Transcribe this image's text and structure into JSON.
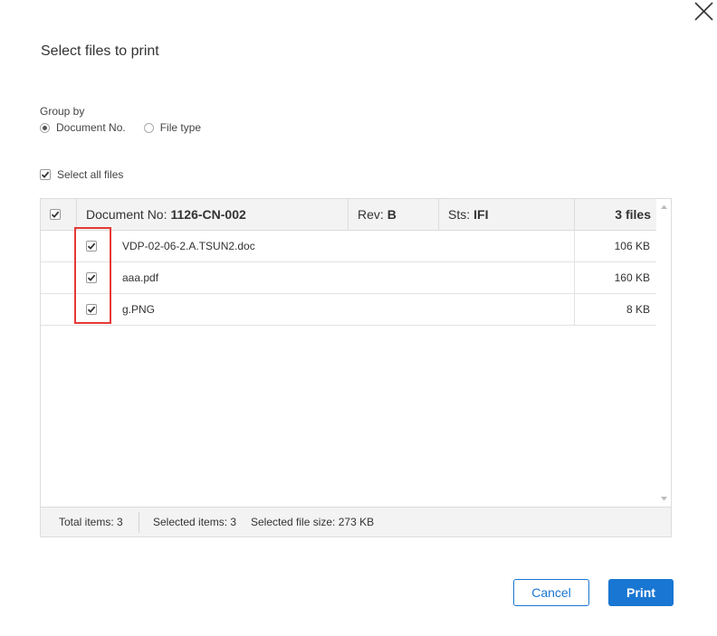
{
  "dialog": {
    "title": "Select files to print",
    "close_icon": "close-icon"
  },
  "group_by": {
    "label": "Group by",
    "options": [
      {
        "label": "Document No.",
        "selected": true
      },
      {
        "label": "File type",
        "selected": false
      }
    ]
  },
  "select_all": {
    "label": "Select all files",
    "checked": true
  },
  "grid": {
    "header": {
      "checked": true,
      "doc_label": "Document No: ",
      "doc_value": "1126-CN-002",
      "rev_label": "Rev: ",
      "rev_value": "B",
      "sts_label": "Sts: ",
      "sts_value": "IFI",
      "files_count": "3 files"
    },
    "rows": [
      {
        "name": "VDP-02-06-2.A.TSUN2.doc",
        "size": "106 KB",
        "checked": true
      },
      {
        "name": "aaa.pdf",
        "size": "160 KB",
        "checked": true
      },
      {
        "name": "g.PNG",
        "size": "8 KB",
        "checked": true
      }
    ],
    "footer": {
      "total_items": "Total items: 3",
      "selected_items": "Selected items: 3",
      "selected_size": "Selected file size: 273 KB"
    }
  },
  "buttons": {
    "cancel": "Cancel",
    "print": "Print"
  },
  "colors": {
    "accent": "#1976d2",
    "highlight": "#e53935"
  }
}
